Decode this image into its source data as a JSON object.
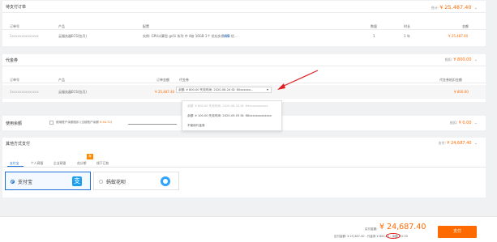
{
  "pending_orders": {
    "title": "待支付订单",
    "total_label": "合计:",
    "total_amount": "¥ 25,487.40",
    "columns": [
      "订单号",
      "产品",
      "配置",
      "数量",
      "时长",
      "金额"
    ],
    "row": {
      "order_no": "2xxxxxxxxxxxxxx",
      "product": "云服务器ECS(包月)",
      "config": "实例: GPU计算型 gn5i 系列 中 4核 16GB 1个 优化实例 I/O 优...",
      "config_link": "详情",
      "qty": "1",
      "duration": "1 年",
      "amount": "¥ 25,487.40"
    }
  },
  "coupon": {
    "title": "代金券",
    "deduct_label": "抵扣:",
    "deduct_amount": "¥ 800.00",
    "columns": [
      "订单号",
      "产品",
      "订单金额",
      "代金券",
      "代金券抵扣金额"
    ],
    "row": {
      "order_no": "2xxxxxxxxxxxxxx",
      "product": "云服务器ECS(包月)",
      "order_amount": "¥ 25,487.40",
      "selected": "余额: ¥ 800.00 失效时间: 2020-06-24 ID: 60xxxxxx...",
      "deduct_amount": "¥ 800.00"
    },
    "options": [
      "余额: ¥ 800.00 失效时间: 2020-06-24 ID: 60xxxxxxxxxxx",
      "余额: ¥ 100.00 失效时间: 2020-09-03 ID: 68xxxxxxxxxxxxx",
      "不使用代金券"
    ]
  },
  "balance": {
    "title": "使用余额",
    "checkbox_label": "使用账户余额抵扣 (当前账户余额",
    "balance_value": "¥ 44.72",
    "balance_suffix": ")",
    "deduct_label": "抵扣:",
    "deduct_amount": "¥ 0.00"
  },
  "payment": {
    "title": "其他方式支付",
    "pay_label": "支付:",
    "pay_amount": "¥ 24,687.40",
    "tabs": [
      "支付宝",
      "个人网银",
      "企业网银",
      "花分期",
      "线下汇款"
    ],
    "active_tab": "支付宝",
    "tab_badge": "荐",
    "options": [
      {
        "label": "支付宝",
        "selected": true,
        "icon": "alipay-icon",
        "icon_glyph": "支"
      },
      {
        "label": "蚂蚁花呗",
        "selected": false,
        "icon": "huabei-icon"
      }
    ]
  },
  "footer": {
    "actual_label": "实付金额:",
    "actual_amount": "¥ 24,687.40",
    "breakdown": "应付金额: ¥ 25,487.40 - 代金券 ¥ 800.00 - 余额 ¥ 0.00",
    "pay_button": "支付"
  },
  "colors": {
    "accent": "#ff6a00",
    "link": "#1f6fd8",
    "annotation": "#e02020"
  }
}
